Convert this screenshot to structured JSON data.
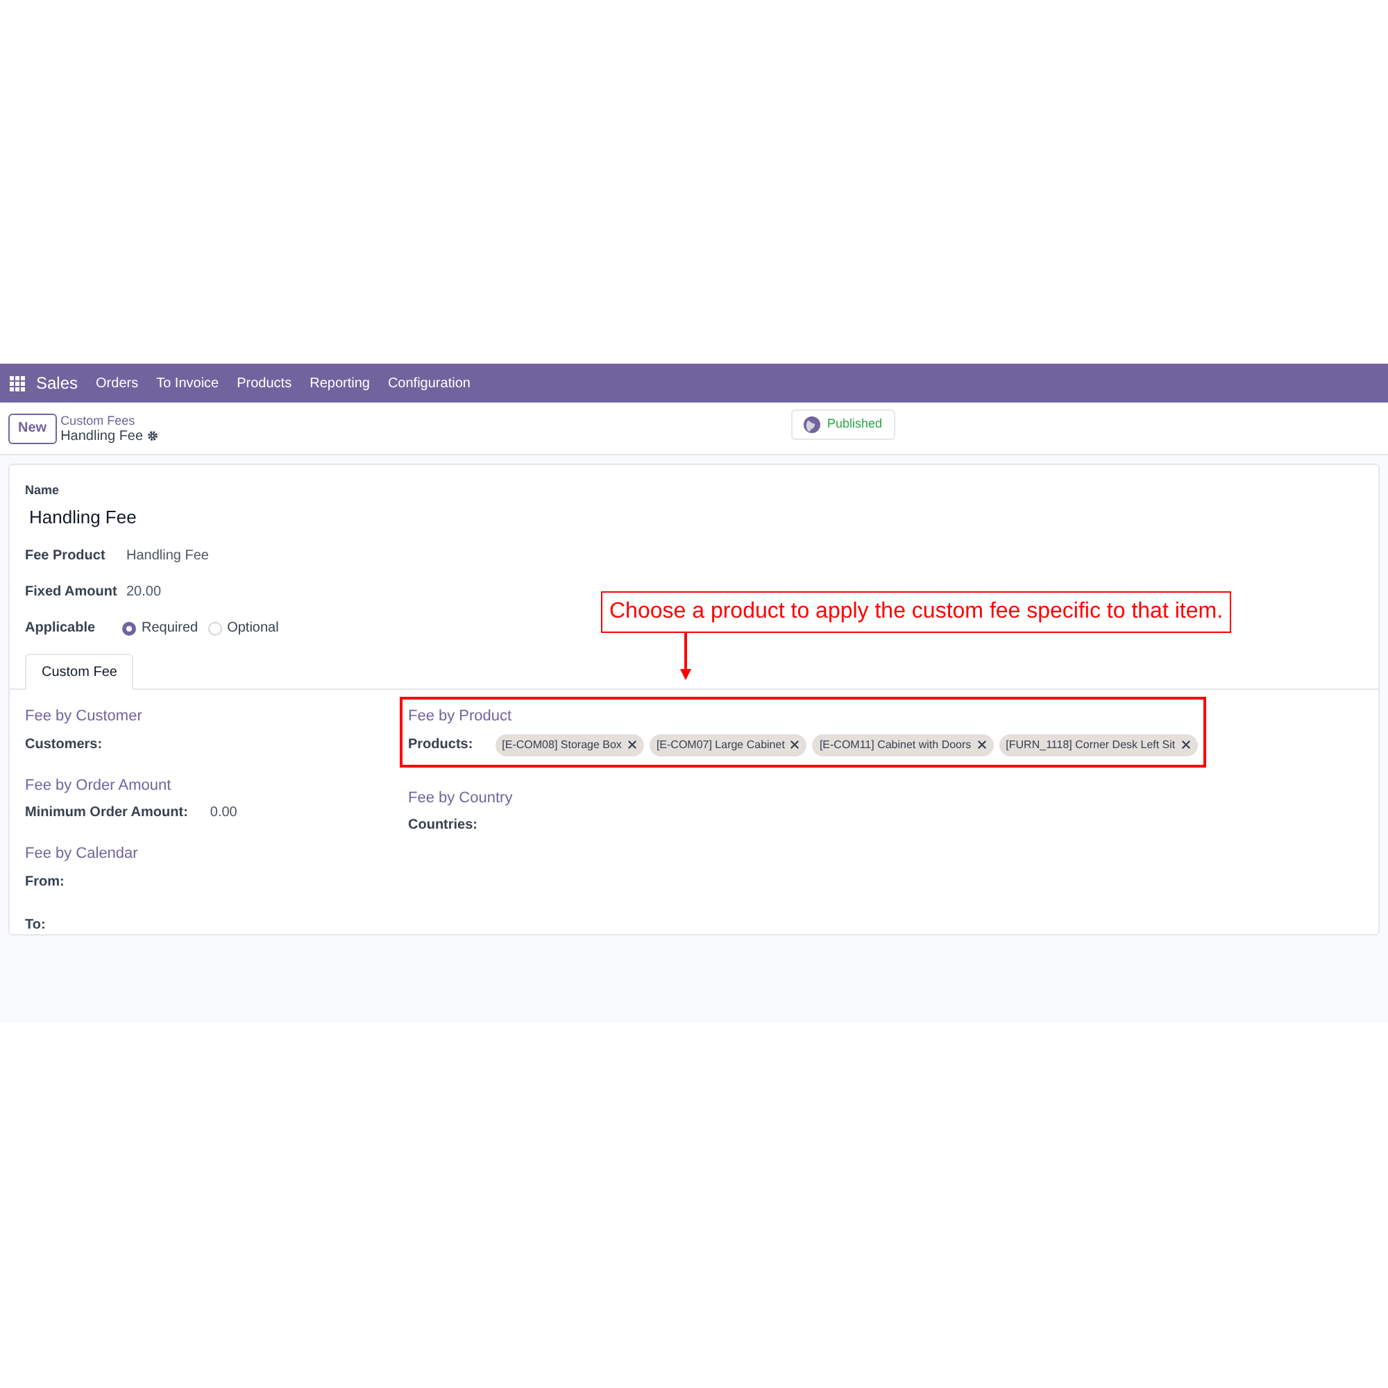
{
  "navbar": {
    "app": "Sales",
    "menu": [
      "Orders",
      "To Invoice",
      "Products",
      "Reporting",
      "Configuration"
    ]
  },
  "control_panel": {
    "new_button": "New",
    "parent": "Custom Fees",
    "current": "Handling Fee",
    "status": "Published"
  },
  "form": {
    "name_label": "Name",
    "name": "Handling Fee",
    "fields": [
      {
        "label": "Fee Product",
        "value": "Handling Fee"
      },
      {
        "label": "Fixed Amount",
        "value": "20.00"
      }
    ],
    "applicable": {
      "label": "Applicable",
      "options": [
        {
          "label": "Required",
          "selected": true
        },
        {
          "label": "Optional",
          "selected": false
        }
      ]
    }
  },
  "tabs": [
    {
      "label": "Custom Fee",
      "selected": true
    }
  ],
  "columns": [
    [
      {
        "title": "Fee by Customer",
        "highlighted": false,
        "fields": [
          {
            "label": "Customers:"
          }
        ]
      },
      {
        "title": "Fee by Order Amount",
        "highlighted": false,
        "fields": [
          {
            "label": "Minimum Order Amount:",
            "value": "0.00"
          }
        ]
      },
      {
        "title": "Fee by Calendar",
        "highlighted": false,
        "fields": [
          {
            "label": "From:"
          },
          {
            "label": "To:"
          }
        ]
      }
    ],
    [
      {
        "title": "Fee by Product",
        "highlighted": true,
        "fields": [
          {
            "label": "Products:",
            "tags": [
              "[E-COM08] Storage Box",
              "[E-COM07] Large Cabinet",
              "[E-COM11] Cabinet with Doors",
              "[FURN_1118] Corner Desk Left Sit"
            ]
          }
        ]
      },
      {
        "title": "Fee by Country",
        "highlighted": false,
        "fields": [
          {
            "label": "Countries:"
          }
        ]
      }
    ]
  ],
  "annotation": {
    "text": "Choose a product to apply the custom fee specific to that item."
  }
}
